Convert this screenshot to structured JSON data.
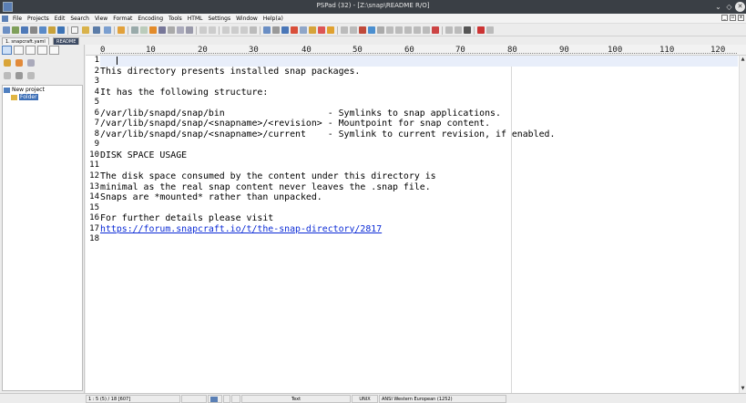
{
  "window": {
    "title": "PSPad (32) - [Z:\\snap\\README R/O]"
  },
  "menu": [
    "File",
    "Projects",
    "Edit",
    "Search",
    "View",
    "Format",
    "Encoding",
    "Tools",
    "HTML",
    "Settings",
    "Window",
    "Help(a)"
  ],
  "tabs": [
    {
      "label": "1. snapcraft.yaml"
    },
    {
      "label": "README"
    }
  ],
  "project_tree": {
    "project": "New project",
    "folder": "Folder"
  },
  "ruler": [
    "0",
    "10",
    "20",
    "30",
    "40",
    "50",
    "60",
    "70",
    "80",
    "90",
    "100",
    "110",
    "120"
  ],
  "editor": {
    "line_numbers": [
      "1",
      "2",
      "3",
      "4",
      "5",
      "6",
      "7",
      "8",
      "9",
      "10",
      "11",
      "12",
      "13",
      "14",
      "15",
      "16",
      "17",
      "18"
    ],
    "lines": [
      "",
      "This directory presents installed snap packages.",
      "",
      "It has the following structure:",
      "",
      "/var/lib/snapd/snap/bin                   - Symlinks to snap applications.",
      "/var/lib/snapd/snap/<snapname>/<revision> - Mountpoint for snap content.",
      "/var/lib/snapd/snap/<snapname>/current    - Symlink to current revision, if enabled.",
      "",
      "DISK SPACE USAGE",
      "",
      "The disk space consumed by the content under this directory is",
      "minimal as the real snap content never leaves the .snap file.",
      "Snaps are *mounted* rather than unpacked.",
      "",
      "For further details please visit",
      "https://forum.snapcraft.io/t/the-snap-directory/2817",
      ""
    ]
  },
  "status": {
    "position": "1 : 5 (5) / 18 [607]",
    "mode": "Text",
    "line_ending": "UNIX",
    "encoding": "ANSI Western European (1252)"
  },
  "colors": {
    "titlebar": "#3a3f45",
    "active_tab": "#3c4a63",
    "link": "#0b2bd6",
    "current_line": "#e8eefa"
  }
}
